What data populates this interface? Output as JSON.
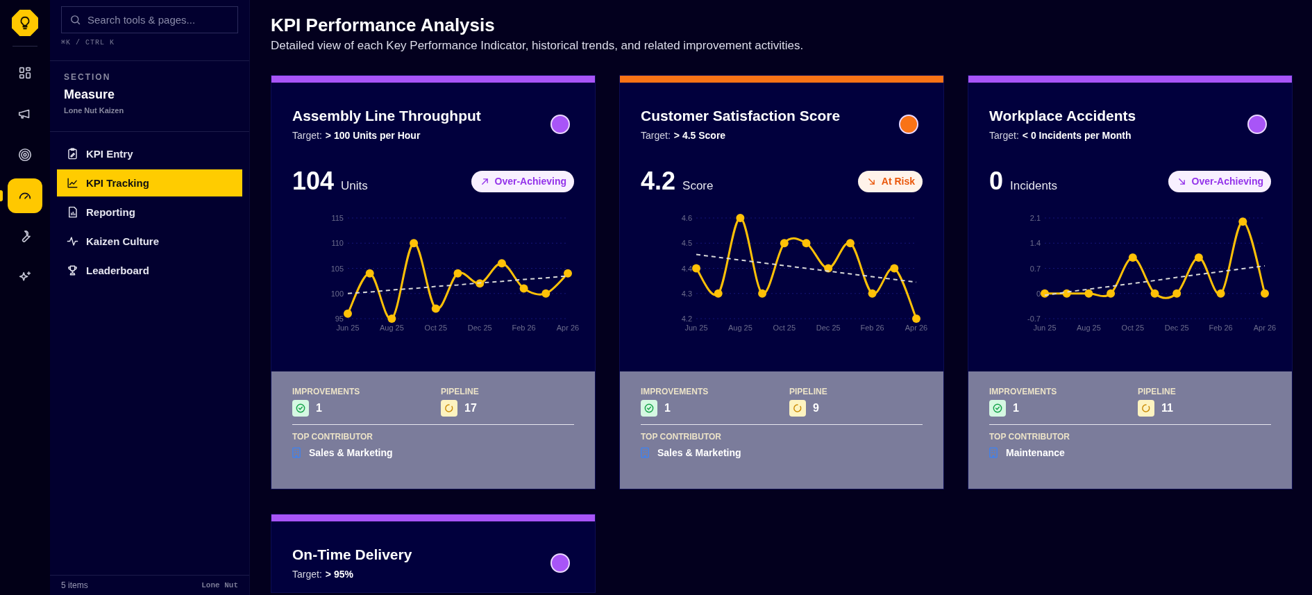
{
  "rail": {
    "items": [
      {
        "selected": false
      },
      {
        "selected": false
      },
      {
        "selected": false
      },
      {
        "selected": true
      },
      {
        "selected": false
      },
      {
        "selected": false
      }
    ]
  },
  "sidebar": {
    "search": {
      "placeholder": "Search tools & pages..."
    },
    "shortcut": "⌘K / CTRL K",
    "section_label": "SECTION",
    "section": "Measure",
    "org": "Lone Nut Kaizen",
    "items": [
      {
        "label": "KPI Entry",
        "selected": false
      },
      {
        "label": "KPI Tracking",
        "selected": true
      },
      {
        "label": "Reporting",
        "selected": false
      },
      {
        "label": "Kaizen Culture",
        "selected": false
      },
      {
        "label": "Leaderboard",
        "selected": false
      }
    ],
    "footer_count": "5 items",
    "footer_brand": "Lone Nut"
  },
  "page": {
    "title": "KPI Performance Analysis",
    "subtitle": "Detailed view of each Key Performance Indicator, historical trends, and related improvement activities."
  },
  "cards": [
    {
      "title": "Assembly Line Throughput",
      "target_label": "Target:",
      "target": "> 100 Units per Hour",
      "color": "#a855f7",
      "value": "104",
      "unit": "Units",
      "badge": {
        "label": "Over-Achieving",
        "at_risk": false,
        "arrow_down": false
      },
      "chart_data": {
        "type": "line",
        "grid": true,
        "series": [
          {
            "color": "#ffc107",
            "marker": true,
            "line_style": "solid",
            "values": [
              96,
              104,
              95,
              110,
              97,
              104,
              102,
              106,
              101,
              100,
              104
            ]
          },
          {
            "color": "#d8d8d8",
            "line_style": "dashed",
            "marker": false,
            "values": [
              100,
              100.3,
              100.7,
              101,
              101.4,
              101.7,
              102.1,
              102.4,
              102.8,
              103.1,
              103.5
            ]
          }
        ],
        "ylim": [
          95,
          115
        ],
        "yticks": [
          95,
          100,
          105,
          110,
          115
        ],
        "categories": [
          "Jun 25",
          null,
          "Aug 25",
          null,
          "Oct 25",
          null,
          "Dec 25",
          null,
          "Feb 26",
          null,
          "Apr 26"
        ]
      },
      "improvements_label": "IMPROVEMENTS",
      "improvements": "1",
      "pipeline_label": "PIPELINE",
      "pipeline": "17",
      "contributor_label": "TOP CONTRIBUTOR",
      "contributor": "Sales & Marketing"
    },
    {
      "title": "Customer Satisfaction Score",
      "target_label": "Target:",
      "target": "> 4.5 Score",
      "color": "#f97316",
      "value": "4.2",
      "unit": "Score",
      "badge": {
        "label": "At Risk",
        "at_risk": true,
        "arrow_down": true
      },
      "chart_data": {
        "type": "line",
        "grid": true,
        "series": [
          {
            "color": "#ffc107",
            "marker": true,
            "line_style": "solid",
            "values": [
              4.4,
              4.3,
              4.6,
              4.3,
              4.5,
              4.5,
              4.4,
              4.5,
              4.3,
              4.4,
              4.2
            ]
          },
          {
            "color": "#d8d8d8",
            "line_style": "dashed",
            "marker": false,
            "values": [
              4.455,
              4.444,
              4.433,
              4.422,
              4.411,
              4.4,
              4.389,
              4.378,
              4.367,
              4.356,
              4.345
            ]
          }
        ],
        "ylim": [
          4.2,
          4.6
        ],
        "yticks": [
          4.2,
          4.3,
          4.4,
          4.5,
          4.6
        ],
        "categories": [
          "Jun 25",
          null,
          "Aug 25",
          null,
          "Oct 25",
          null,
          "Dec 25",
          null,
          "Feb 26",
          null,
          "Apr 26"
        ]
      },
      "improvements_label": "IMPROVEMENTS",
      "improvements": "1",
      "pipeline_label": "PIPELINE",
      "pipeline": "9",
      "contributor_label": "TOP CONTRIBUTOR",
      "contributor": "Sales & Marketing"
    },
    {
      "title": "Workplace Accidents",
      "target_label": "Target:",
      "target": "< 0 Incidents per Month",
      "color": "#a855f7",
      "value": "0",
      "unit": "Incidents",
      "badge": {
        "label": "Over-Achieving",
        "at_risk": false,
        "arrow_down": true
      },
      "chart_data": {
        "type": "line",
        "grid": true,
        "series": [
          {
            "color": "#ffc107",
            "marker": true,
            "line_style": "solid",
            "values": [
              0,
              0,
              0,
              0,
              1,
              0,
              0,
              1,
              0,
              2,
              0
            ]
          },
          {
            "color": "#d8d8d8",
            "line_style": "dashed",
            "marker": false,
            "values": [
              -0.05,
              0.04,
              0.12,
              0.2,
              0.28,
              0.36,
              0.45,
              0.53,
              0.61,
              0.69,
              0.77
            ]
          }
        ],
        "ylim": [
          -0.7,
          2.1
        ],
        "yticks": [
          -0.7,
          0,
          0.7,
          1.4,
          2.1
        ],
        "categories": [
          "Jun 25",
          null,
          "Aug 25",
          null,
          "Oct 25",
          null,
          "Dec 25",
          null,
          "Feb 26",
          null,
          "Apr 26"
        ]
      },
      "improvements_label": "IMPROVEMENTS",
      "improvements": "1",
      "pipeline_label": "PIPELINE",
      "pipeline": "11",
      "contributor_label": "TOP CONTRIBUTOR",
      "contributor": "Maintenance"
    },
    {
      "title": "On-Time Delivery",
      "target_label": "Target:",
      "target": "> 95%",
      "color": "#a855f7"
    }
  ]
}
